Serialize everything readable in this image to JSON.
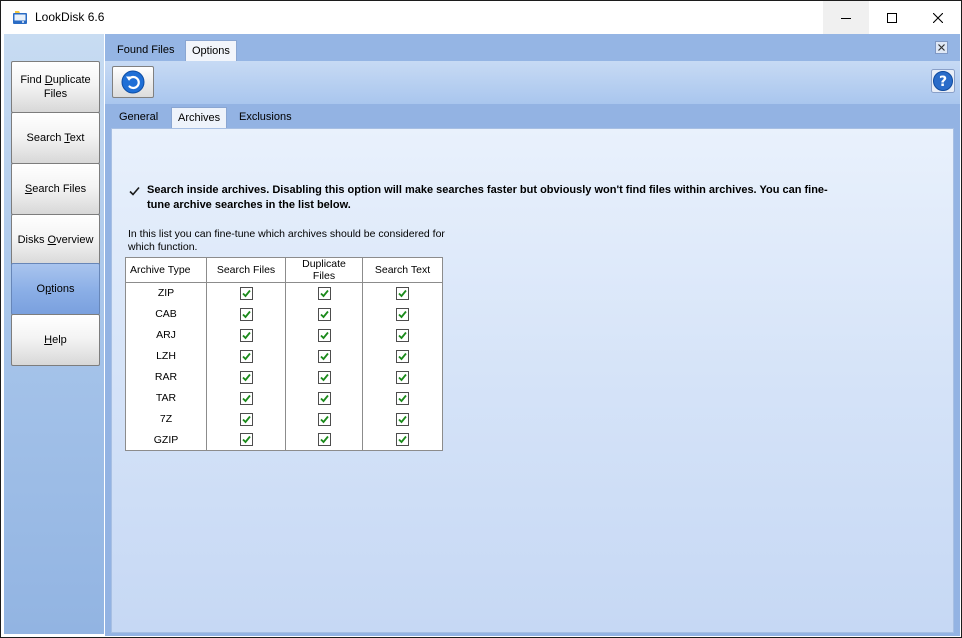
{
  "window": {
    "title": "LookDisk 6.6",
    "icon": "lookdisk-app-icon"
  },
  "nav": {
    "find_duplicate": {
      "pre": "Find ",
      "key": "D",
      "post": "uplicate Files"
    },
    "search_text": {
      "pre": "Search ",
      "key": "T",
      "post": "ext"
    },
    "search_files": {
      "pre": "",
      "key": "S",
      "post": "earch Files"
    },
    "disks_overview": {
      "pre": "Disks ",
      "key": "O",
      "post": "verview"
    },
    "options": {
      "pre": "O",
      "key": "p",
      "post": "tions"
    },
    "help": {
      "pre": "",
      "key": "H",
      "post": "elp"
    },
    "active": "options"
  },
  "main_tabs": {
    "found_files": "Found Files",
    "options": "Options"
  },
  "sub_tabs": {
    "general": "General",
    "archives": "Archives",
    "exclusions": "Exclusions"
  },
  "archives": {
    "search_inside_checked": true,
    "search_inside_label": "Search inside archives.  Disabling this option will make searches faster but obviously won't find files within archives. You can fine-tune archive searches in the list below.",
    "list_description": "In this list you can fine-tune which archives should be considered for which function.",
    "columns": [
      "Archive Type",
      "Search Files",
      "Duplicate Files",
      "Search Text"
    ],
    "rows": [
      {
        "type": "ZIP",
        "search_files": true,
        "duplicate_files": true,
        "search_text": true
      },
      {
        "type": "CAB",
        "search_files": true,
        "duplicate_files": true,
        "search_text": true
      },
      {
        "type": "ARJ",
        "search_files": true,
        "duplicate_files": true,
        "search_text": true
      },
      {
        "type": "LZH",
        "search_files": true,
        "duplicate_files": true,
        "search_text": true
      },
      {
        "type": "RAR",
        "search_files": true,
        "duplicate_files": true,
        "search_text": true
      },
      {
        "type": "TAR",
        "search_files": true,
        "duplicate_files": true,
        "search_text": true
      },
      {
        "type": "7Z",
        "search_files": true,
        "duplicate_files": true,
        "search_text": true
      },
      {
        "type": "GZIP",
        "search_files": true,
        "duplicate_files": true,
        "search_text": true
      }
    ]
  },
  "colors": {
    "check_green": "#1a8a1a",
    "accent_blue": "#1a6fd0"
  }
}
